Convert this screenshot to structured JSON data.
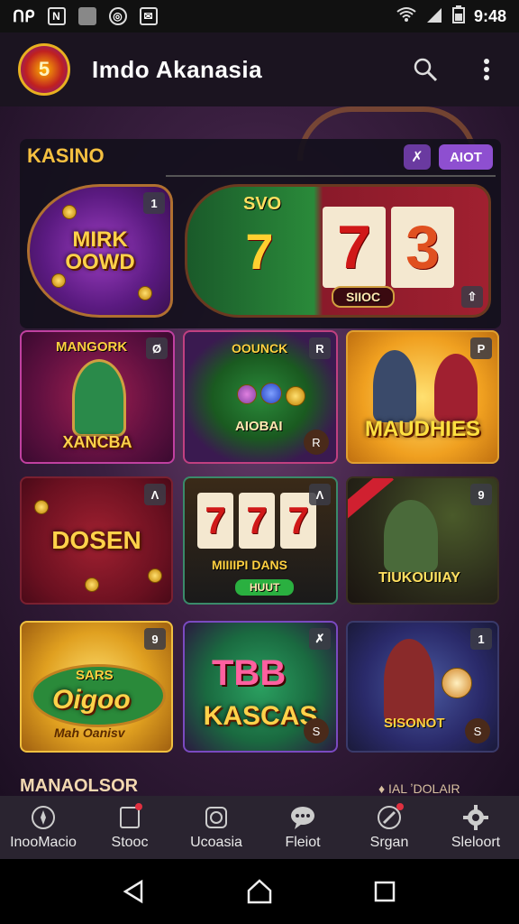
{
  "status_bar": {
    "left_text": "ᑎᑭ",
    "time": "9:48",
    "icons": [
      "n-icon",
      "square-icon",
      "cast-icon",
      "mail-icon",
      "wifi-icon",
      "signal-icon",
      "battery-icon"
    ]
  },
  "header": {
    "logo_text": "5",
    "title": "Imdo Akanasia"
  },
  "section": {
    "title": "KASINO",
    "filter_icon": "✗",
    "about_label": "AIOT"
  },
  "tiles": [
    {
      "title": "MIRK OOWD",
      "badge": "1"
    },
    {
      "title_top": "SVO",
      "reels": [
        "7",
        "7",
        "3"
      ],
      "label": "SIIOC",
      "badge": "⇧"
    },
    {
      "title_top": "MANGORK",
      "title": "XANCBA",
      "badge": "Ø"
    },
    {
      "title_top": "OOUNCK",
      "title": "AIOBAI",
      "badge": "R",
      "badge2": "R"
    },
    {
      "title": "MAUDHIES",
      "badge": "P"
    },
    {
      "title": "DOSEN",
      "badge": "Λ"
    },
    {
      "reels": [
        "7",
        "7",
        "7"
      ],
      "label": "MIIIIPI DANS",
      "button": "HUUT",
      "badge": "Λ"
    },
    {
      "title": "TIUKOUIIAY",
      "badge": "9"
    },
    {
      "title_top": "SARS",
      "title": "Oigoo",
      "label": "Mah Oanisv",
      "badge": "9"
    },
    {
      "title_top": "TBB",
      "title": "KASCAS",
      "badge": "✗",
      "badge2": "S"
    },
    {
      "title": "SISONOT",
      "badge": "1",
      "badge2": "S"
    }
  ],
  "more": {
    "title": "MANAOLSOR",
    "link": "♦ IAL ʼDOLAIR"
  },
  "bottom_nav": [
    {
      "label": "InooMacio",
      "icon": "compass-icon",
      "dot": false
    },
    {
      "label": "Stooc",
      "icon": "tablet-icon",
      "dot": true
    },
    {
      "label": "Ucoasia",
      "icon": "coin-icon",
      "dot": false
    },
    {
      "label": "Fleiot",
      "icon": "chat-icon",
      "dot": false
    },
    {
      "label": "Srgan",
      "icon": "pen-icon",
      "dot": true
    },
    {
      "label": "Sleloort",
      "icon": "gear-icon",
      "dot": false
    }
  ],
  "colors": {
    "accent_gold": "#f5c040",
    "accent_purple": "#8e4fd0",
    "nav_bg": "#2a2430"
  }
}
